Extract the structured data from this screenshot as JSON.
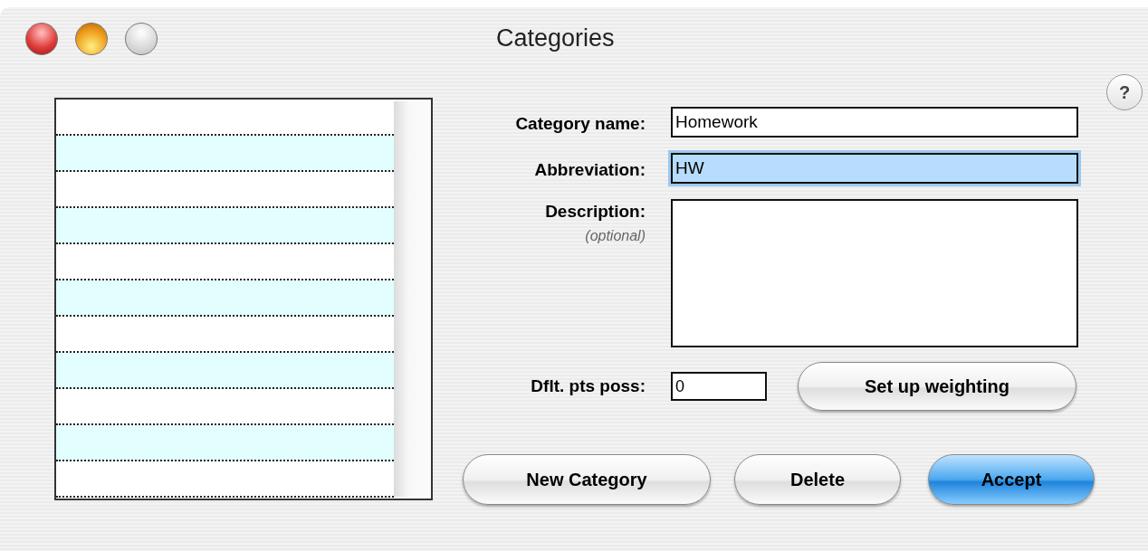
{
  "window": {
    "title": "Categories",
    "controls": [
      {
        "kind": "close",
        "disabled": false
      },
      {
        "kind": "minimize",
        "disabled": false
      },
      {
        "kind": "zoom",
        "disabled": true
      }
    ]
  },
  "help_button": {
    "label": "?"
  },
  "category_list": {
    "rows": [
      {
        "selected": false
      },
      {
        "selected": false
      },
      {
        "selected": false
      },
      {
        "selected": false
      },
      {
        "selected": false
      },
      {
        "selected": false
      },
      {
        "selected": false
      },
      {
        "selected": false
      },
      {
        "selected": false
      },
      {
        "selected": false
      },
      {
        "selected": false
      }
    ]
  },
  "form": {
    "fields": [
      {
        "kind": "line",
        "label": "Category name:",
        "value": "Homework",
        "focused": false
      },
      {
        "kind": "line",
        "label": "Abbreviation:",
        "value": "HW",
        "focused": true
      },
      {
        "kind": "area",
        "label": "Description:",
        "hint": "(optional)",
        "focused": false
      }
    ]
  },
  "default_points": {
    "label": "Dflt. pts poss:",
    "value": "0"
  },
  "setup_button": {
    "label": "Set up weighting",
    "default": false
  },
  "buttons": [
    {
      "label": "New Category",
      "default": false
    },
    {
      "label": "Delete",
      "default": false
    },
    {
      "label": "Accept",
      "default": true
    }
  ]
}
